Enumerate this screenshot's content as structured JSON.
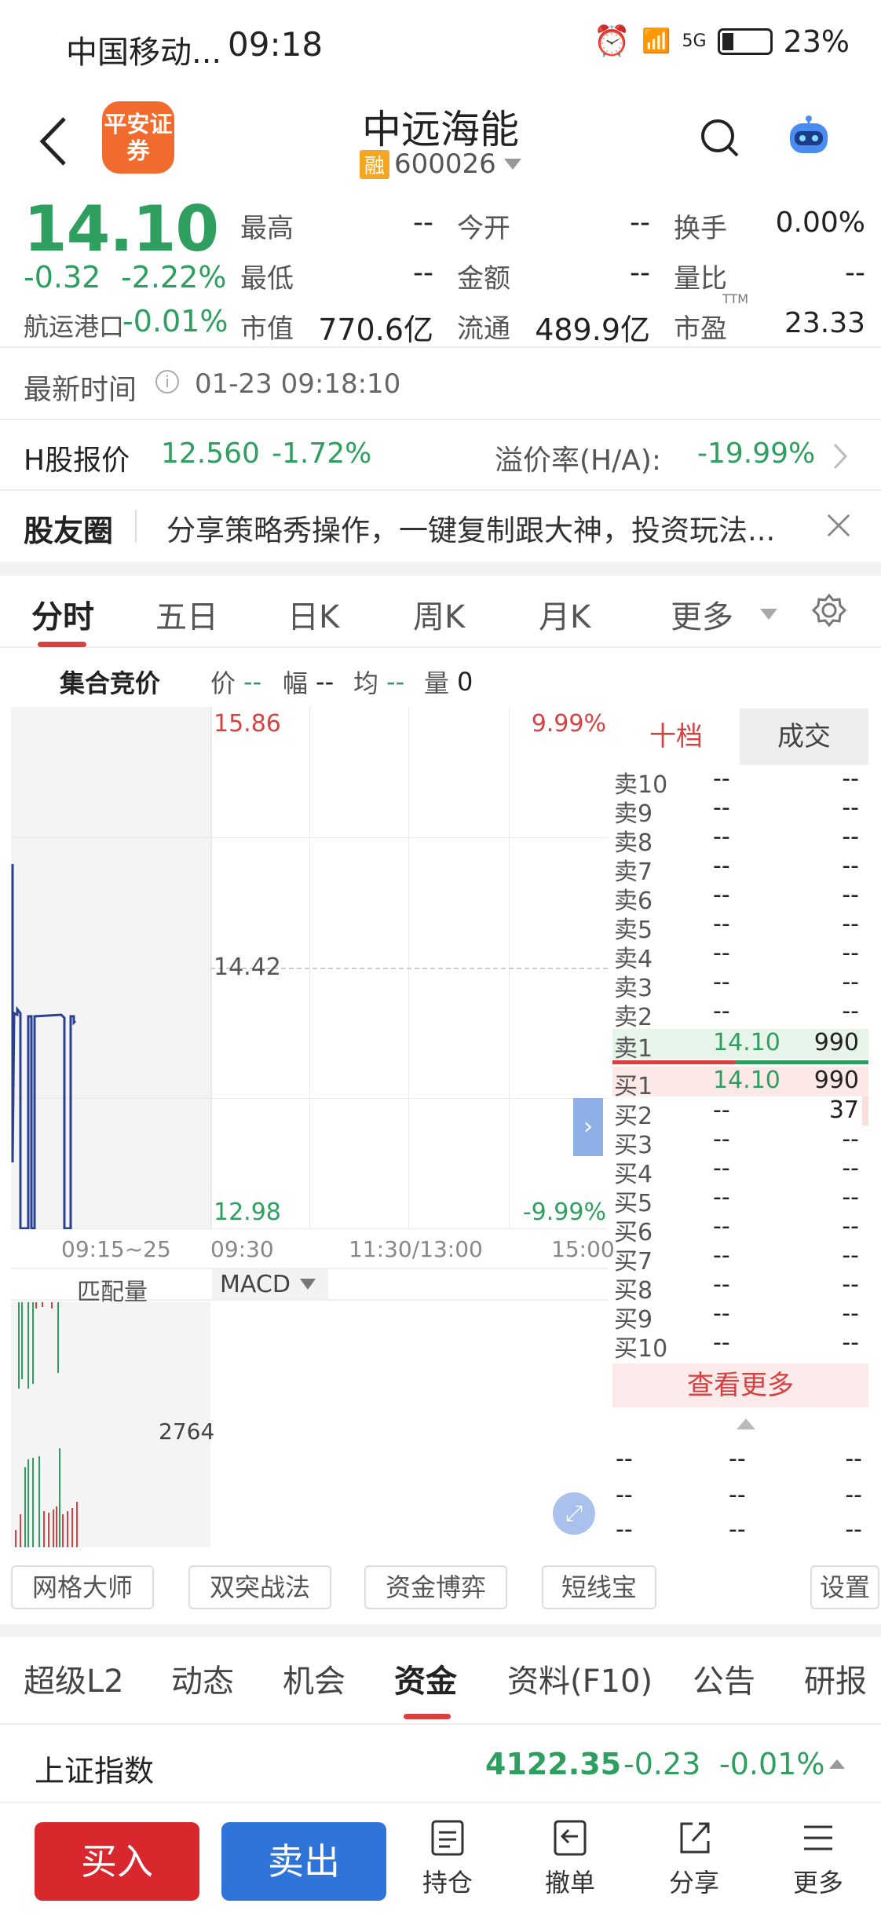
{
  "status": {
    "carrier": "中国移动...",
    "time": "09:18",
    "signal": "5G",
    "battery": "23%"
  },
  "header": {
    "logo_text": "平安证券",
    "stock_name": "中远海能",
    "badge": "融",
    "stock_code": "600026"
  },
  "quote": {
    "price": "14.10",
    "change": "-0.32",
    "change_pct": "-2.22%",
    "sector_label": "航运港口",
    "sector_value": "-0.01%",
    "fields": [
      {
        "label": "最高",
        "value": "--"
      },
      {
        "label": "今开",
        "value": "--"
      },
      {
        "label": "换手",
        "value": "0.00%"
      },
      {
        "label": "最低",
        "value": "--"
      },
      {
        "label": "金额",
        "value": "--"
      },
      {
        "label": "量比",
        "value": "--"
      },
      {
        "label": "市值",
        "value": "770.6亿"
      },
      {
        "label": "流通",
        "value": "489.9亿"
      },
      {
        "label": "市盈",
        "value": "23.33",
        "sup": "TTM"
      }
    ]
  },
  "latest": {
    "label": "最新时间",
    "value": "01-23 09:18:10"
  },
  "hshare": {
    "label": "H股报价",
    "price": "12.560",
    "pct": "-1.72%",
    "premium_label": "溢价率(H/A):",
    "premium_value": "-19.99%"
  },
  "community": {
    "label": "股友圈",
    "text": "分享策略秀操作，一键复制跟大神，投资玩法..."
  },
  "tabs": [
    "分时",
    "五日",
    "日K",
    "周K",
    "月K",
    "更多"
  ],
  "chart": {
    "auction_label": "集合竞价",
    "stats": [
      {
        "label": "价",
        "value": "--"
      },
      {
        "label": "幅",
        "value": "--"
      },
      {
        "label": "均",
        "value": "--"
      },
      {
        "label": "量",
        "value": "0"
      }
    ],
    "high": "15.86",
    "high_pct": "9.99%",
    "mid": "14.42",
    "low": "12.98",
    "low_pct": "-9.99%",
    "time_labels": [
      "09:15~25",
      "09:30",
      "11:30/13:00",
      "15:00"
    ],
    "vol_label": "匹配量",
    "indicator": "MACD",
    "vol_value": "2764"
  },
  "orderbook": {
    "tabs": [
      "十档",
      "成交"
    ],
    "sells": [
      {
        "label": "卖10",
        "price": "--",
        "vol": "--"
      },
      {
        "label": "卖9",
        "price": "--",
        "vol": "--"
      },
      {
        "label": "卖8",
        "price": "--",
        "vol": "--"
      },
      {
        "label": "卖7",
        "price": "--",
        "vol": "--"
      },
      {
        "label": "卖6",
        "price": "--",
        "vol": "--"
      },
      {
        "label": "卖5",
        "price": "--",
        "vol": "--"
      },
      {
        "label": "卖4",
        "price": "--",
        "vol": "--"
      },
      {
        "label": "卖3",
        "price": "--",
        "vol": "--"
      },
      {
        "label": "卖2",
        "price": "--",
        "vol": "--"
      },
      {
        "label": "卖1",
        "price": "14.10",
        "vol": "990"
      }
    ],
    "buys": [
      {
        "label": "买1",
        "price": "14.10",
        "vol": "990"
      },
      {
        "label": "买2",
        "price": "--",
        "vol": "37"
      },
      {
        "label": "买3",
        "price": "--",
        "vol": "--"
      },
      {
        "label": "买4",
        "price": "--",
        "vol": "--"
      },
      {
        "label": "买5",
        "price": "--",
        "vol": "--"
      },
      {
        "label": "买6",
        "price": "--",
        "vol": "--"
      },
      {
        "label": "买7",
        "price": "--",
        "vol": "--"
      },
      {
        "label": "买8",
        "price": "--",
        "vol": "--"
      },
      {
        "label": "买9",
        "price": "--",
        "vol": "--"
      },
      {
        "label": "买10",
        "price": "--",
        "vol": "--"
      }
    ],
    "more": "查看更多",
    "trades": [
      [
        "--",
        "--",
        "--"
      ],
      [
        "--",
        "--",
        "--"
      ],
      [
        "--",
        "--",
        "--"
      ]
    ]
  },
  "tools": [
    "网格大师",
    "双突战法",
    "资金博弈",
    "短线宝",
    "设置"
  ],
  "bottom_tabs": [
    "超级L2",
    "动态",
    "机会",
    "资金",
    "资料(F10)",
    "公告",
    "研报"
  ],
  "index": {
    "name": "上证指数",
    "value": "4122.35",
    "change": "-0.23",
    "pct": "-0.01%"
  },
  "actions": {
    "buy": "买入",
    "sell": "卖出",
    "nav": [
      "持仓",
      "撤单",
      "分享",
      "更多"
    ]
  },
  "colors": {
    "up": "#d94040",
    "down": "#2e9f5f",
    "buy_button": "#d9272e",
    "sell_button": "#2f74d9"
  }
}
